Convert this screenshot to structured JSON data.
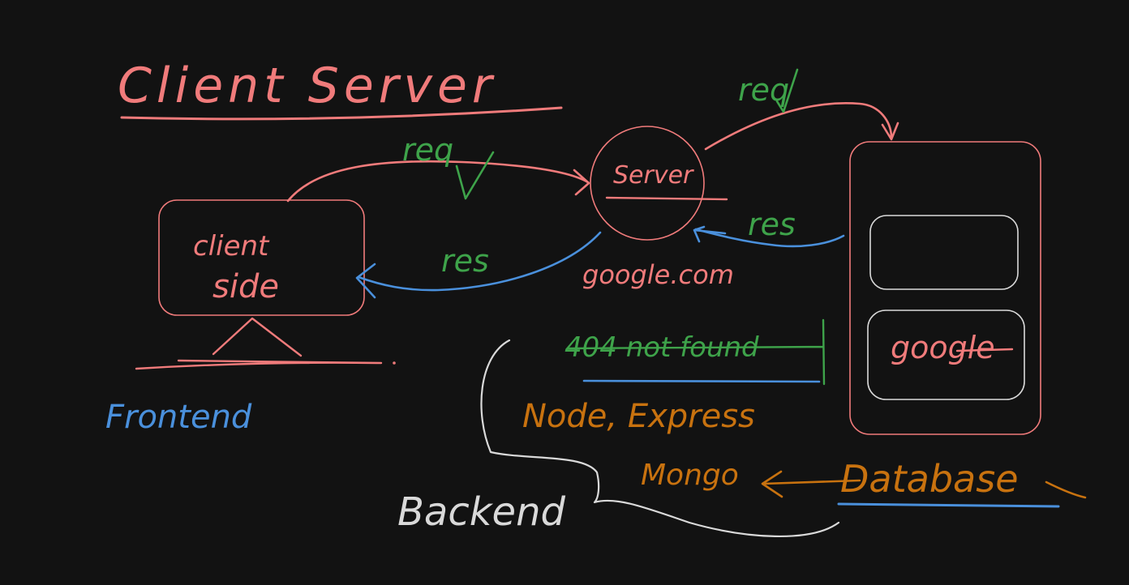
{
  "colors": {
    "background": "#121212",
    "red": "#f07b7b",
    "green": "#3ea34a",
    "blue": "#4a90dc",
    "orange": "#c8720f",
    "white": "#d9d9d9"
  },
  "title": "Client Server",
  "client": {
    "line1": "client",
    "line2": "side",
    "label": "Frontend"
  },
  "server": {
    "label": "Server",
    "domain": "google.com"
  },
  "database": {
    "entry": "google",
    "label": "Database"
  },
  "arrows": {
    "client_to_server": "req",
    "server_to_db": "req",
    "db_to_server": "res",
    "server_to_client": "res"
  },
  "backend": {
    "error": "404 not found",
    "stack": "Node, Express",
    "db_tech": "Mongo",
    "label": "Backend"
  }
}
